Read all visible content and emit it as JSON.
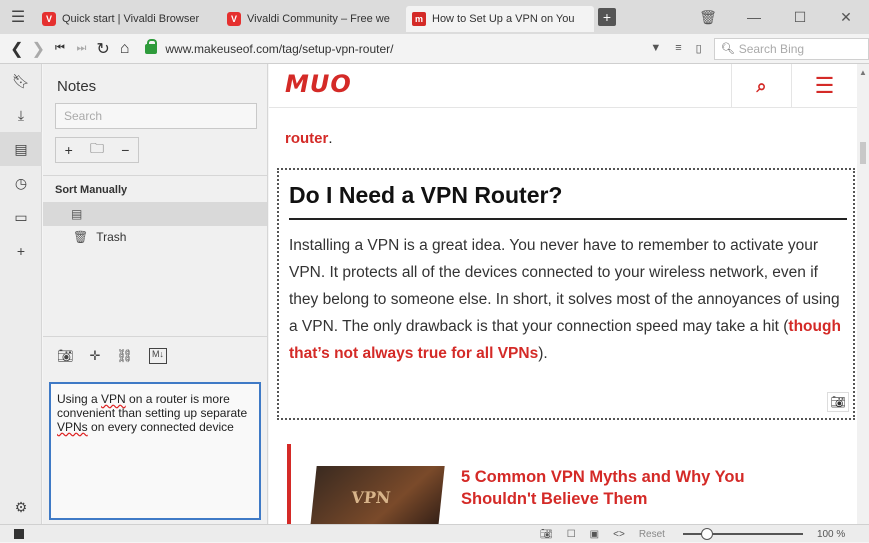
{
  "tabs": [
    {
      "title": "Quick start | Vivaldi Browser",
      "icon": "vivaldi-icon"
    },
    {
      "title": "Vivaldi Community – Free we",
      "icon": "vivaldi-icon"
    },
    {
      "title": "How to Set Up a VPN on You",
      "icon": "makeuseof-icon",
      "active": true
    }
  ],
  "addressbar": {
    "url": "www.makeuseof.com/tag/setup-vpn-router/",
    "search_placeholder": "Search Bing"
  },
  "notes_panel": {
    "title": "Notes",
    "search_placeholder": "Search",
    "toolbar": {
      "add": "+",
      "folder": "folder-icon",
      "remove": "−"
    },
    "sort_label": "Sort Manually",
    "trash_label": "Trash",
    "editor_text_parts": [
      "Using a ",
      "VPN",
      " on a router is more convenient than setting up separate ",
      "VPNs",
      " on every connected device"
    ]
  },
  "page": {
    "logo": "MUO",
    "prev_link": "router",
    "prev_link_suffix": ".",
    "heading": "Do I Need a VPN Router?",
    "paragraph": "Installing a VPN is a great idea. You never have to remember to activate your VPN. It protects all of the devices connected to your wireless network, even if they belong to someone else. In short, it solves most of the annoyances of using a VPN. The only drawback is that your connection speed may take a hit (",
    "paragraph_link": "though that’s not always true for all VPNs",
    "paragraph_end": ").",
    "related_title": "5 Common VPN Myths and Why You Shouldn't Believe Them",
    "related_thumb_text": "VPN"
  },
  "statusbar": {
    "reset_label": "Reset",
    "zoom": "100 %",
    "zoom_level": 0.2
  },
  "colors": {
    "accent": "#d42a27",
    "editor_border": "#3f7ac6"
  }
}
